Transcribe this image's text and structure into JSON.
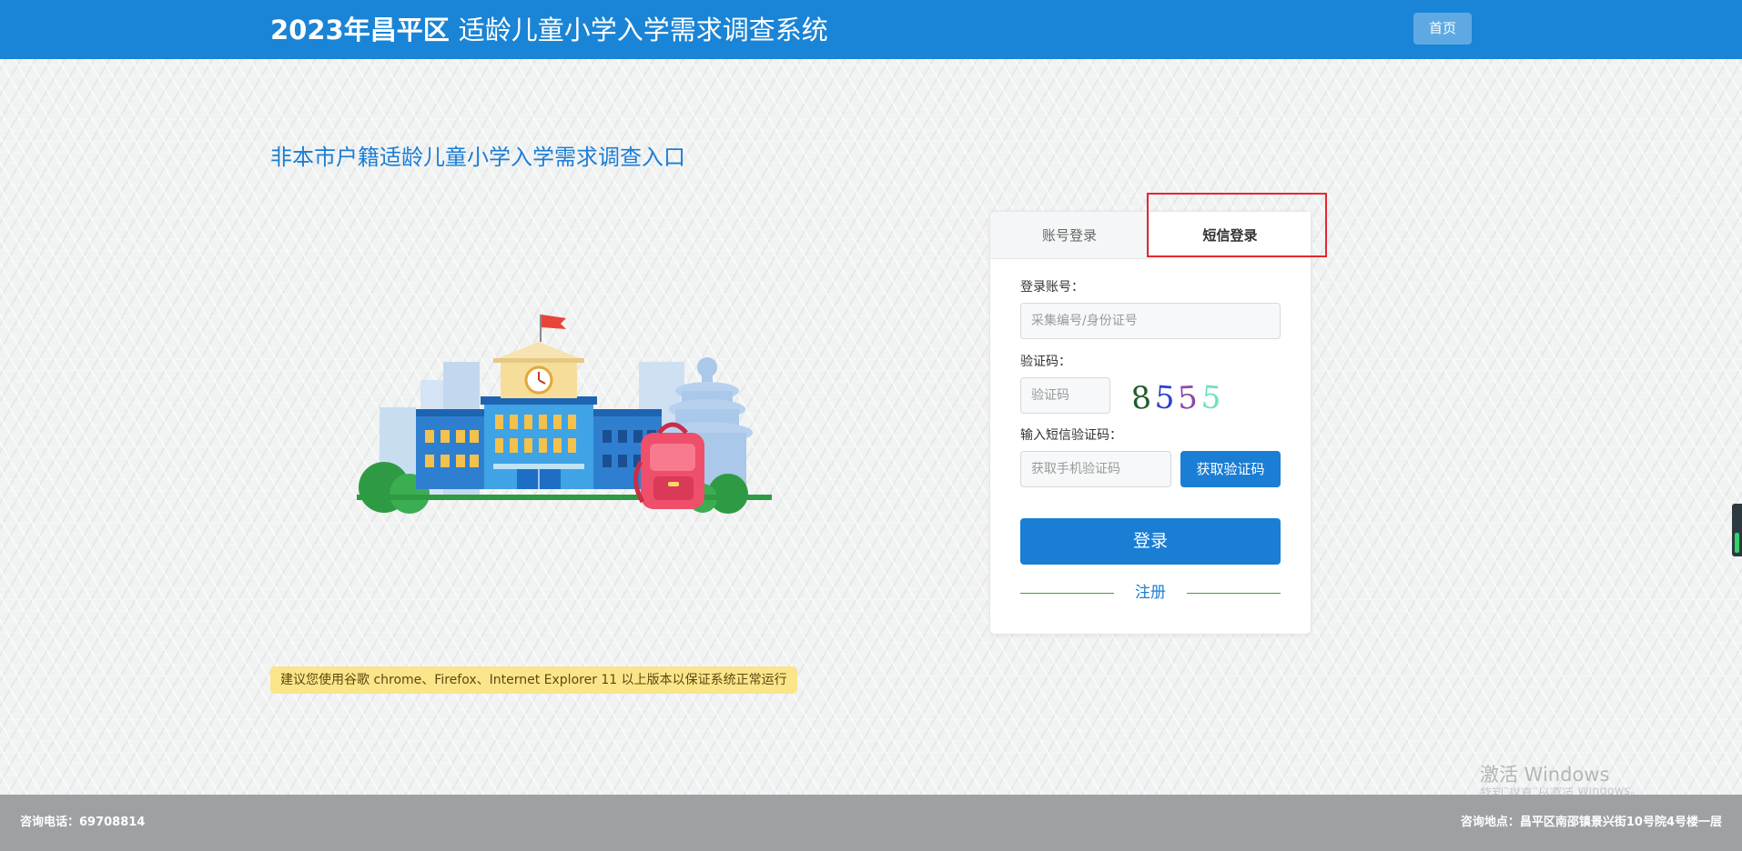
{
  "header": {
    "title_year": "2023年昌平区",
    "title_main": "适龄儿童小学入学需求调查系统",
    "home_label": "首页"
  },
  "entry_title": "非本市户籍适龄儿童小学入学需求调查入口",
  "login": {
    "tabs": [
      {
        "label": "账号登录",
        "active": false
      },
      {
        "label": "短信登录",
        "active": true
      }
    ],
    "account_label": "登录账号：",
    "account_placeholder": "采集编号/身份证号",
    "captcha_label": "验证码：",
    "captcha_placeholder": "验证码",
    "captcha_chars": [
      "8",
      "5",
      "5",
      "5"
    ],
    "sms_label": "输入短信验证码：",
    "sms_placeholder": "获取手机验证码",
    "sms_button": "获取验证码",
    "login_button": "登录",
    "register_link": "注册"
  },
  "browser_tip": "建议您使用谷歌 chrome、Firefox、Internet Explorer 11 以上版本以保证系统正常运行",
  "watermark": {
    "title": "激活 Windows",
    "subtitle": "转到\"设置\"以激活 Windows。"
  },
  "footer": {
    "phone": "咨询电话：69708814",
    "address": "咨询地点：昌平区南邵镇景兴街10号院4号楼一层"
  },
  "colors": {
    "brand_blue": "#1a84d6",
    "button_blue": "#1a7ed4",
    "highlight_red": "#e8262d",
    "tip_yellow": "#fbe58a",
    "footer_gray": "#9ea1a3"
  },
  "icons": {
    "illustration": "school-building-illustration"
  }
}
